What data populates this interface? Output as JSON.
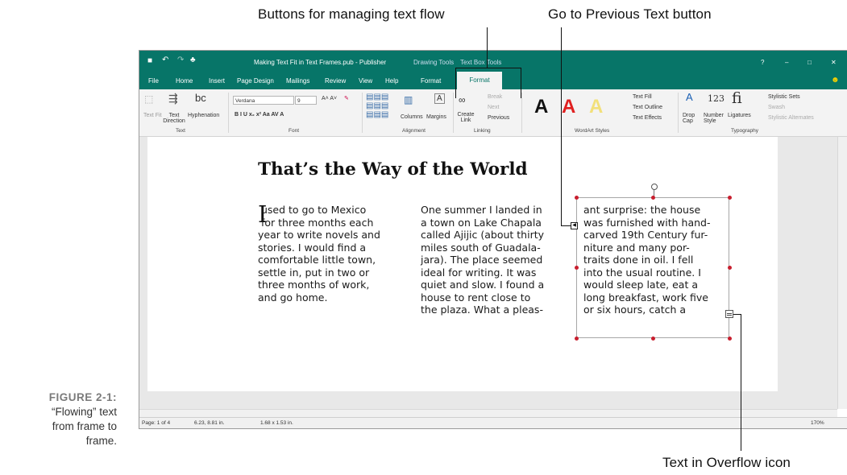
{
  "callouts": {
    "text_flow_buttons": "Buttons for managing text flow",
    "previous_button": "Go to Previous Text button",
    "overflow_icon": "Text in Overflow icon"
  },
  "caption": {
    "figure": "FIGURE 2-1:",
    "line1": "“Flowing” text",
    "line2": "from frame to",
    "line3": "frame."
  },
  "titlebar": {
    "doc_title": "Making Text Fit in Text Frames.pub - Publisher",
    "drawing_tools": "Drawing Tools",
    "text_box_tools": "Text Box Tools",
    "help": "?",
    "minimize": "–",
    "restore": "□",
    "close": "✕"
  },
  "tabs": [
    "File",
    "Home",
    "Insert",
    "Page Design",
    "Mailings",
    "Review",
    "View",
    "Help",
    "Format",
    "Format"
  ],
  "ribbon": {
    "text_fit": "Text Fit",
    "text_direction": "Text Direction",
    "hyphenation": "Hyphenation",
    "group_text": "Text",
    "font_name": "Verdana",
    "font_size": "9",
    "group_font": "Font",
    "columns": "Columns",
    "margins": "Margins",
    "group_alignment": "Alignment",
    "create_link": "Create Link",
    "break": "Break",
    "next": "Next",
    "previous": "Previous",
    "group_linking": "Linking",
    "text_fill": "Text Fill",
    "text_outline": "Text Outline",
    "text_effects": "Text Effects",
    "group_wordart": "WordArt Styles",
    "drop_cap": "Drop Cap",
    "number_style": "Number Style",
    "ligatures": "Ligatures",
    "stylistic_sets": "Stylistic Sets",
    "swash": "Swash",
    "stylistic_alternates": "Stylistic Alternates",
    "group_typography": "Typography",
    "wordart_sample": "A",
    "number_sample": "123",
    "lig_sample": "fi"
  },
  "document": {
    "heading": "That’s the Way of the World",
    "dropcap": "I",
    "col1": " used to go to Mexico\n for three months each\nyear to write novels and\nstories. I would find a\ncomfortable little town,\nsettle in, put in two or\nthree months of work,\nand go home.",
    "col2": "One summer I landed in\na town on Lake Chapala\ncalled Ajijic (about thirty\nmiles south of Guadala-\njara). The place seemed\nideal for writing. It was\nquiet and slow. I found a\nhouse to rent close to\nthe plaza. What a pleas-",
    "col3": "ant surprise: the house\nwas furnished with hand-\ncarved 19th Century fur-\nniture and many por-\ntraits done in oil. I fell\ninto the usual routine. I\nwould sleep late, eat a\nlong breakfast, work five\nor six hours, catch a"
  },
  "status": {
    "page": "Page: 1 of 4",
    "position": "6.23, 8.81 in.",
    "size": "1.68 x 1.53 in.",
    "zoom": "170%"
  }
}
